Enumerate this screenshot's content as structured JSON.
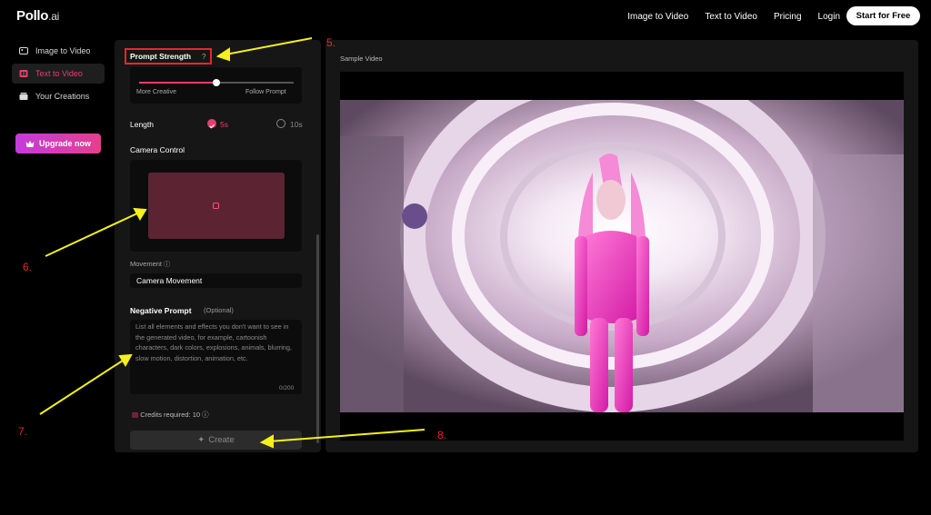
{
  "nav": {
    "logo": "Pollo",
    "logo_suffix": ".ai",
    "links": [
      "Image to Video",
      "Text to Video",
      "Pricing",
      "Login"
    ],
    "cta": "Start for Free"
  },
  "sidebar": {
    "items": [
      {
        "label": "Image to Video",
        "icon": "image-icon"
      },
      {
        "label": "Text to Video",
        "icon": "text-video-icon"
      },
      {
        "label": "Your Creations",
        "icon": "creations-icon"
      }
    ],
    "upgrade": "Upgrade now"
  },
  "form": {
    "prompt_strength": "Prompt Strength",
    "help": "?",
    "slider_left": "More Creative",
    "slider_right": "Follow Prompt",
    "slider_value": 0.5,
    "length_label": "Length",
    "length_opt1": "5s",
    "length_opt2": "10s",
    "camera_control": "Camera Control",
    "movement_label": "Movement",
    "movement_value": "Camera Movement",
    "negative_label": "Negative Prompt",
    "negative_optional": "(Optional)",
    "negative_placeholder": "List all elements and effects you don't want to see in the generated video, for example, cartoonish characters, dark colors, explosions, animals, blurring, slow motion, distortion, animation, etc.",
    "char_count": "0/200",
    "credits": "Credits required: 10",
    "create": "Create"
  },
  "preview": {
    "label": "Sample Video"
  },
  "annotations": [
    "5.",
    "6.",
    "7.",
    "8."
  ],
  "colors": {
    "accent": "#e83e6e",
    "annotation": "#e3292f",
    "arrow": "#f4f11c"
  }
}
